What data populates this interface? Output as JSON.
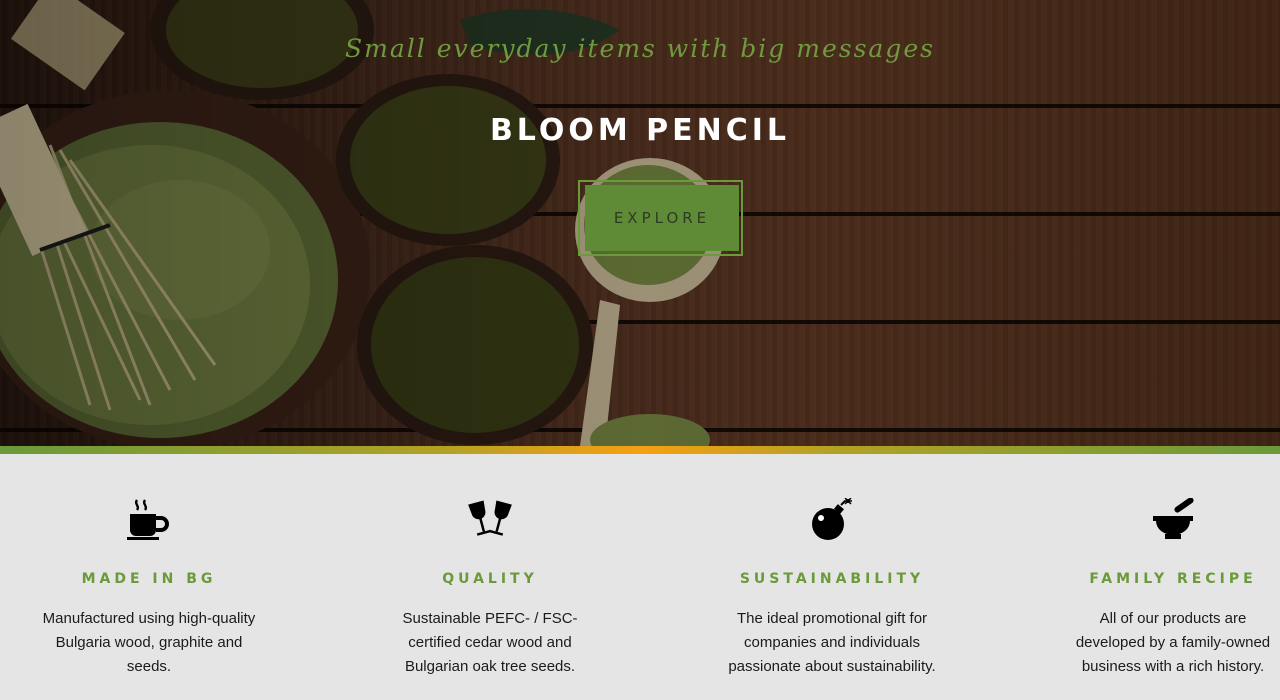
{
  "hero": {
    "tagline": "Small everyday items with big messages",
    "title": "BLOOM PENCIL",
    "cta_label": "EXPLORE"
  },
  "colors": {
    "accent_green": "#6a9a3a",
    "button_green": "#5f8b37",
    "divider_orange": "#f5a012"
  },
  "features": [
    {
      "icon": "coffee-cup-icon",
      "title": "MADE IN BG",
      "description": "Manufactured using high-quality Bulgaria wood, graphite and seeds."
    },
    {
      "icon": "wine-glasses-icon",
      "title": "QUALITY",
      "description": "Sustainable PEFC- / FSC-certified cedar wood and Bulgarian oak tree seeds."
    },
    {
      "icon": "bomb-icon",
      "title": "SUSTAINABILITY",
      "description": "The ideal promotional gift for companies and individuals passionate about sustainability."
    },
    {
      "icon": "mortar-pestle-icon",
      "title": "FAMILY RECIPE",
      "description": "All of our products are developed by a family-owned business with a rich history."
    }
  ]
}
